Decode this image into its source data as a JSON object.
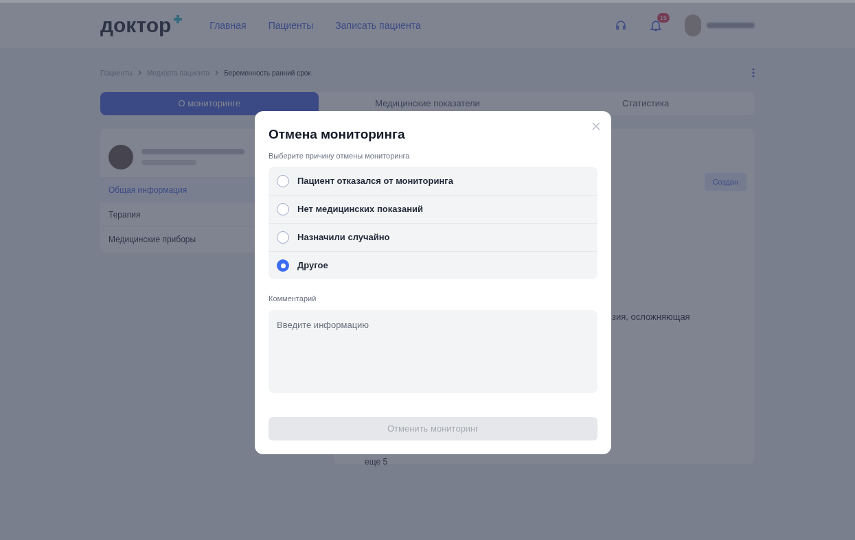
{
  "header": {
    "logo": "доктор",
    "nav": [
      {
        "label": "Главная"
      },
      {
        "label": "Пациенты"
      },
      {
        "label": "Записать пациента"
      }
    ],
    "notifications": "15"
  },
  "breadcrumbs": [
    "Пациенты",
    "Медкорта пациента",
    "Беременность ранний срок"
  ],
  "tabs": [
    {
      "label": "О мониторинге",
      "selected": true
    },
    {
      "label": "Медицинские показатели",
      "selected": false
    },
    {
      "label": "Статистика",
      "selected": false
    }
  ],
  "sidebar": {
    "items": [
      {
        "label": "Общая информация",
        "selected": true
      },
      {
        "label": "Терапия",
        "selected": false
      },
      {
        "label": "Медицинские приборы",
        "selected": false
      }
    ]
  },
  "content": {
    "status_button": "Создан",
    "text_fragment": "зия, осложняющая",
    "more": "еще 5"
  },
  "modal": {
    "title": "Отмена мониторинга",
    "subtitle": "Выберите причину отмены мониторинга",
    "options": [
      {
        "label": "Пациент отказался от мониторинга",
        "selected": false
      },
      {
        "label": "Нет медицинских показаний",
        "selected": false
      },
      {
        "label": "Назначили случайно",
        "selected": false
      },
      {
        "label": "Другое",
        "selected": true
      }
    ],
    "comment_label": "Комментарий",
    "comment_placeholder": "Введите информацию",
    "submit": {
      "label": "Отменить мониторинг",
      "disabled": true
    }
  }
}
